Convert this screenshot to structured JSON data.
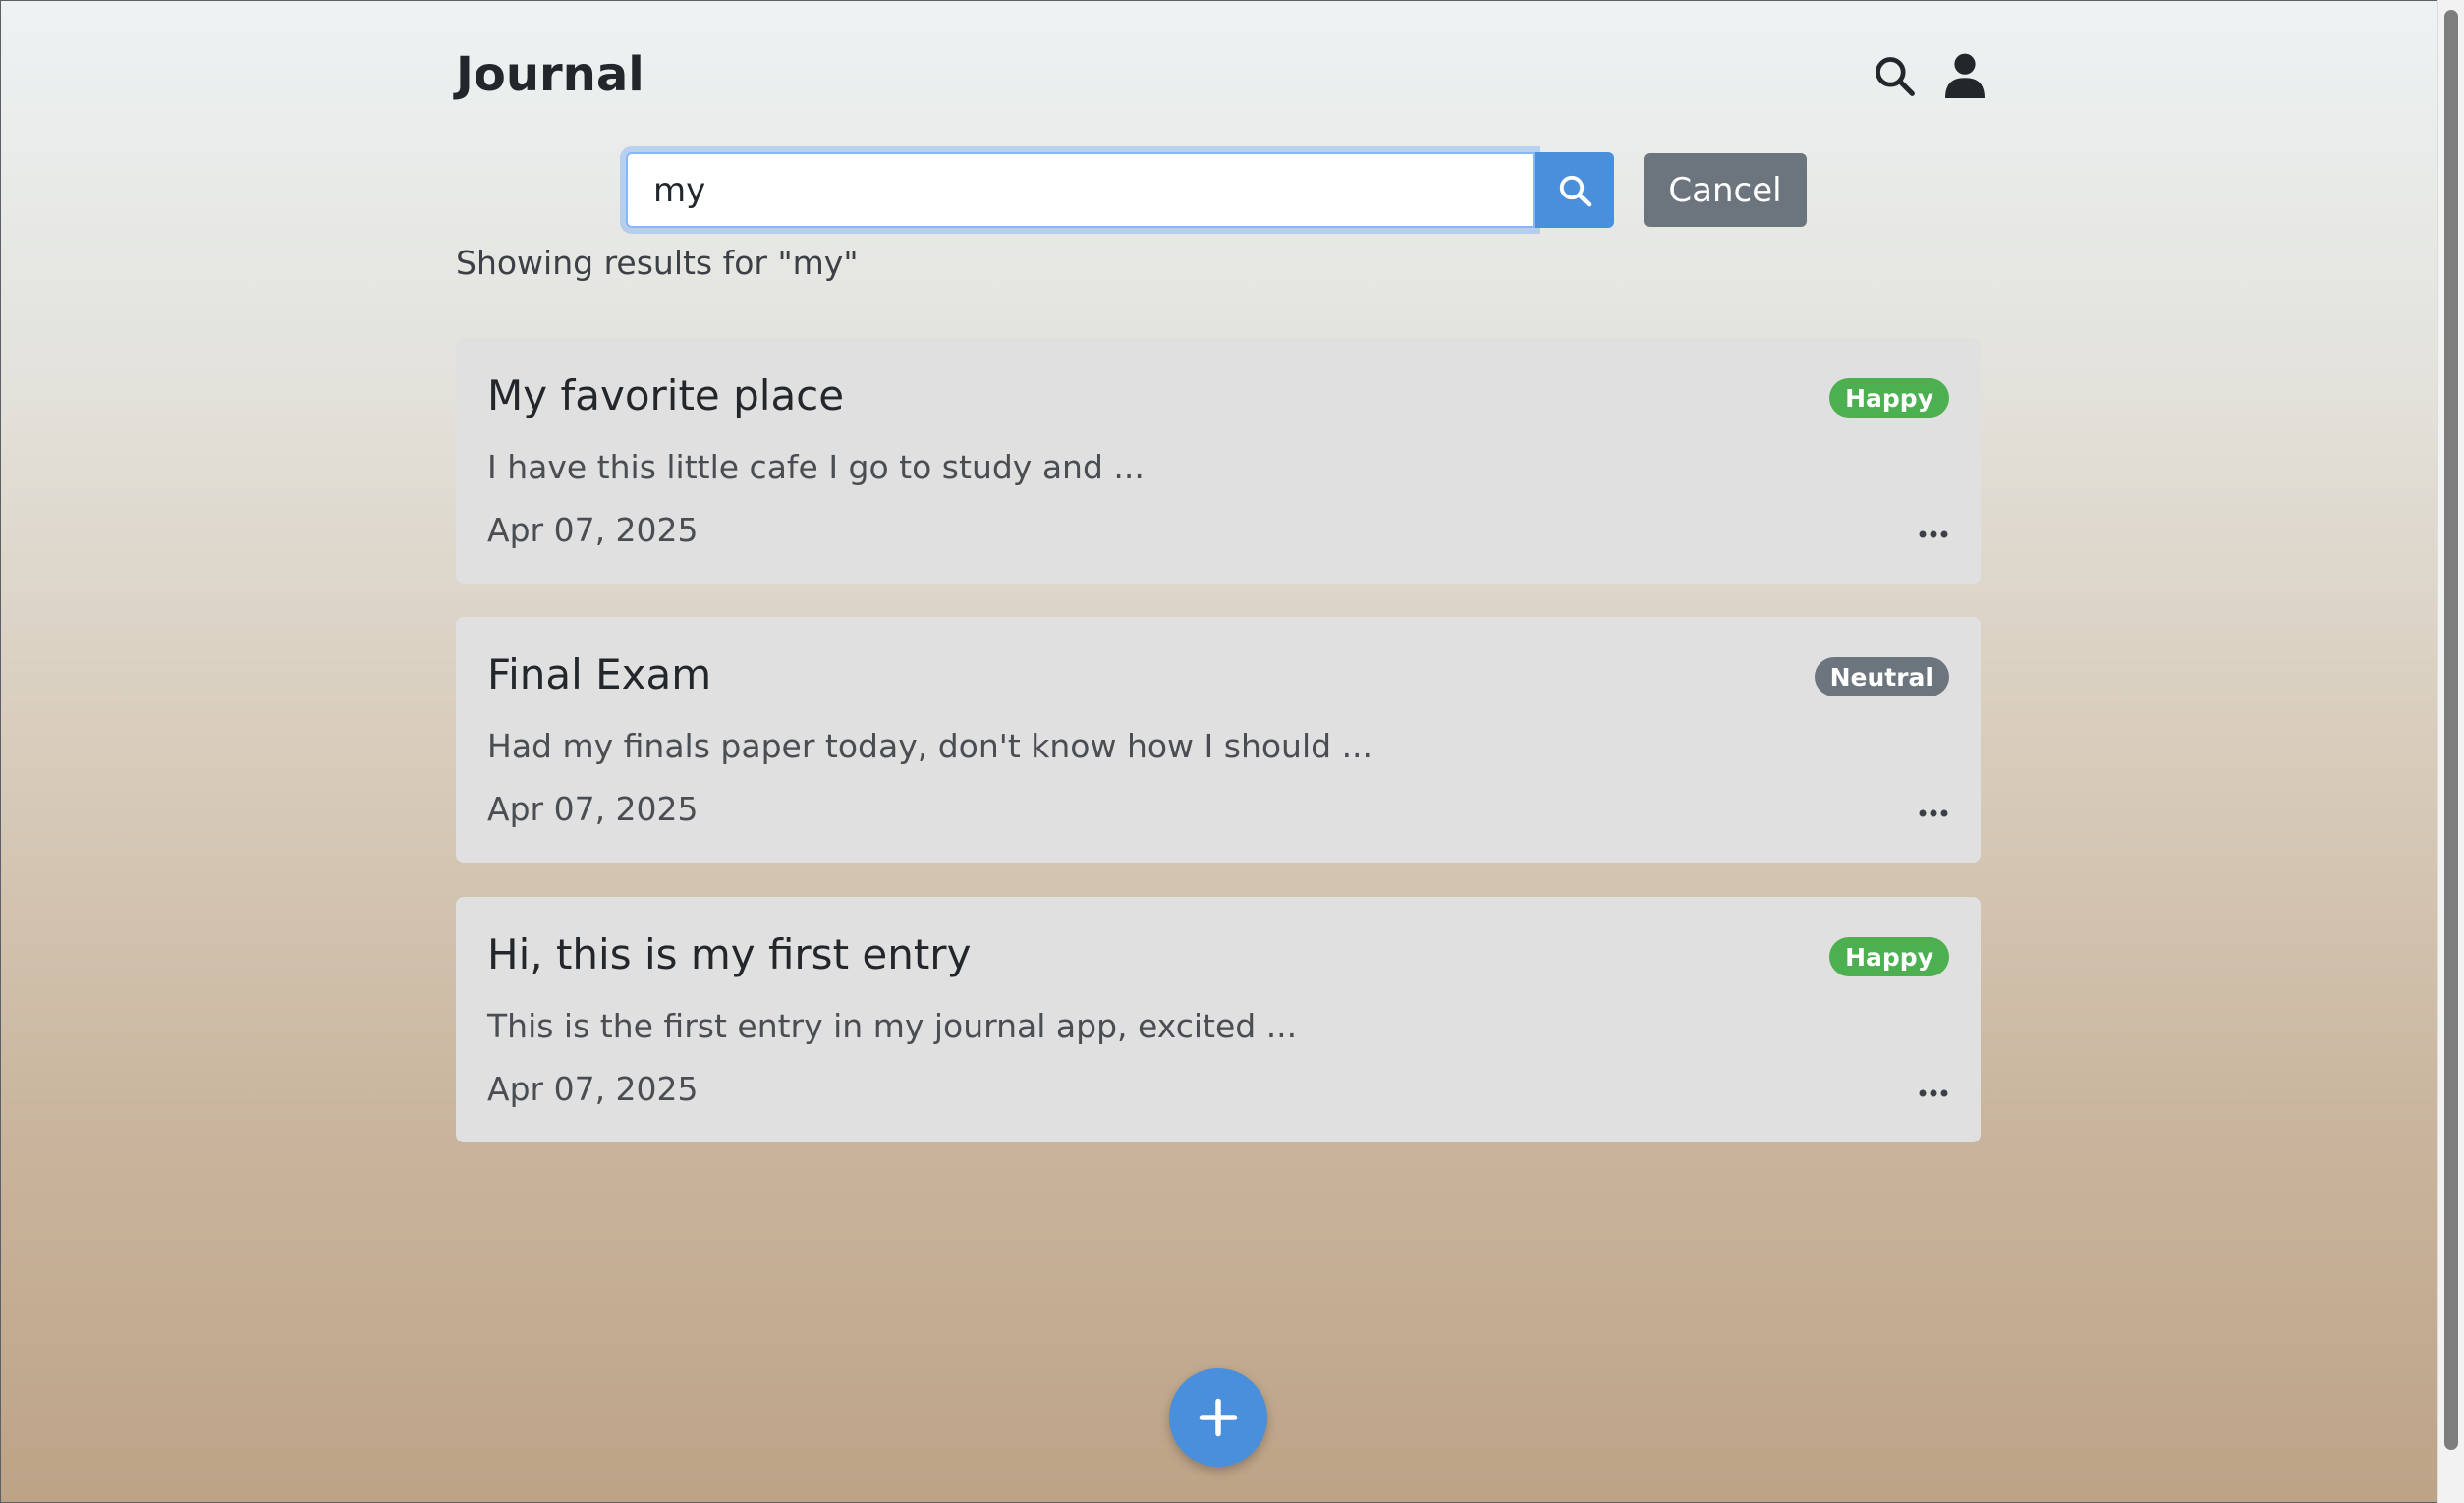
{
  "app": {
    "title": "Journal",
    "header_icons": [
      "search-icon",
      "user-icon"
    ]
  },
  "search": {
    "value": "my",
    "placeholder": "",
    "submit_icon": "search-icon",
    "cancel_label": "Cancel",
    "results_text": "Showing results for \"my\""
  },
  "entries": [
    {
      "title": "My favorite place",
      "snippet": "I have this little cafe I go to study and ...",
      "date": "Apr 07, 2025",
      "mood": "Happy",
      "mood_color": "#4caf50"
    },
    {
      "title": "Final Exam",
      "snippet": "Had my finals paper today, don't know how I should ...",
      "date": "Apr 07, 2025",
      "mood": "Neutral",
      "mood_color": "#6c757d"
    },
    {
      "title": "Hi, this is my first entry",
      "snippet": "This is the first entry in my journal app, excited ...",
      "date": "Apr 07, 2025",
      "mood": "Happy",
      "mood_color": "#4caf50"
    }
  ],
  "entry_menu_icon": "more-horizontal-icon",
  "fab": {
    "icon": "plus-icon",
    "color": "#4a8fdb"
  },
  "colors": {
    "accent": "#4a8fdb",
    "cancel": "#6c757d",
    "card": "#e0e0e0"
  }
}
